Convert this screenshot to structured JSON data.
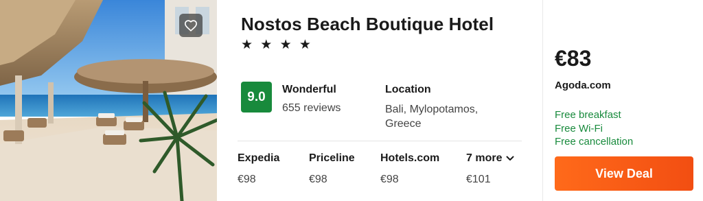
{
  "hotel": {
    "name": "Nostos Beach Boutique Hotel",
    "stars_text": "★ ★ ★ ★",
    "star_count": 4
  },
  "rating": {
    "score": "9.0",
    "label": "Wonderful",
    "reviews": "655 reviews",
    "badge_color": "#188a3c"
  },
  "location": {
    "title": "Location",
    "text": "Bali, Mylopotamos, Greece"
  },
  "providers": [
    {
      "name": "Expedia",
      "price": "€98"
    },
    {
      "name": "Priceline",
      "price": "€98"
    },
    {
      "name": "Hotels.com",
      "price": "€98"
    }
  ],
  "more_providers": {
    "label": "7 more",
    "price": "€101"
  },
  "deal": {
    "price": "€83",
    "site": "Agoda.com",
    "perks": [
      "Free breakfast",
      "Free Wi-Fi",
      "Free cancellation"
    ],
    "button_label": "View Deal",
    "button_color": "#f4581a",
    "perk_color": "#188a3c"
  },
  "icons": {
    "favorite": "heart-icon",
    "more": "chevron-down-icon"
  }
}
